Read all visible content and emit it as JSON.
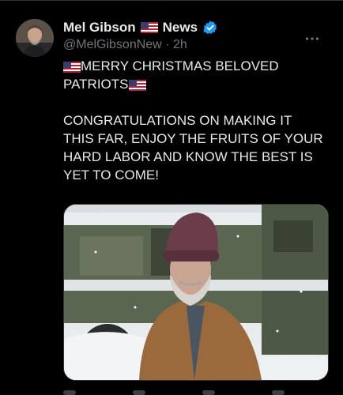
{
  "tweet": {
    "author_name": "Mel Gibson",
    "author_suffix": "News",
    "handle": "@MelGibsonNew",
    "separator": "·",
    "time": "2h",
    "text": {
      "line1": "MERRY CHRISTMAS BELOVED",
      "line2": "PATRIOTS",
      "line3": "CONGRATULATIONS ON MAKING IT",
      "line4": "THIS FAR, ENJOY THE FRUITS OF YOUR",
      "line5": "HARD LABOR AND KNOW THE BEST IS",
      "line6": "YET TO COME!"
    }
  },
  "icons": {
    "more": "more-icon",
    "verified": "verified-badge-icon",
    "flag": "us-flag-icon"
  },
  "colors": {
    "background": "#000000",
    "text": "#e7e9ea",
    "secondary_text": "#71767b",
    "verified_blue": "#1d9bf0"
  }
}
